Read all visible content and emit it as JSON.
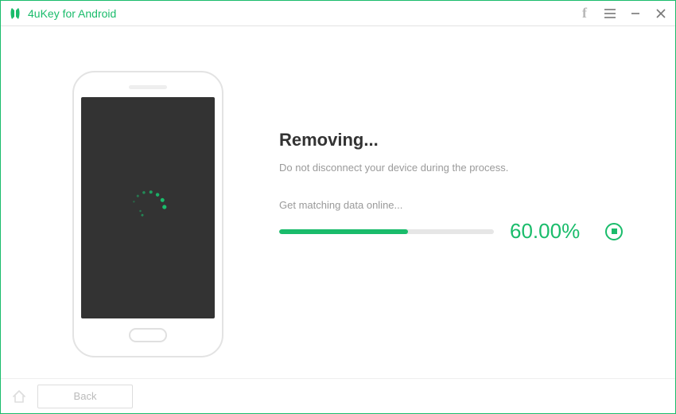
{
  "app": {
    "title": "4uKey for Android"
  },
  "titlebar": {
    "facebook": "f"
  },
  "progress": {
    "heading": "Removing...",
    "warning": "Do not disconnect your device during the process.",
    "step_label": "Get matching data online...",
    "percent_value": 60.0,
    "percent_text": "60.00%"
  },
  "footer": {
    "back_label": "Back"
  },
  "colors": {
    "accent": "#1abc6b"
  }
}
